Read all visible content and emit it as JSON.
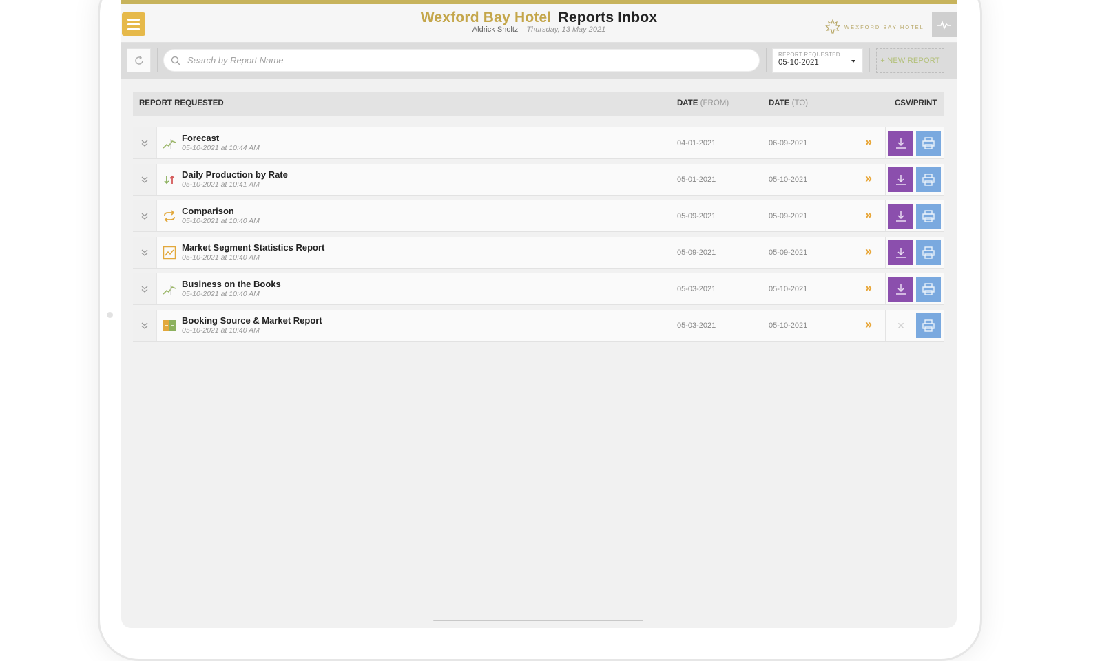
{
  "header": {
    "hotel_name": "Wexford Bay Hotel",
    "page_title": "Reports Inbox",
    "user_name": "Aldrick Sholtz",
    "date": "Thursday, 13 May 2021",
    "logo_text": "WEXFORD BAY HOTEL",
    "menu_icon": "hamburger-icon",
    "activity_icon": "pulse-icon",
    "accent_color": "#c4a64a"
  },
  "toolbar": {
    "search_placeholder": "Search by Report Name",
    "search_value": "",
    "date_filter_label": "REPORT REQUESTED",
    "date_filter_value": "05-10-2021",
    "new_report_label": "+ NEW REPORT"
  },
  "table": {
    "columns": {
      "report": "REPORT REQUESTED",
      "date_from": "DATE",
      "date_from_suffix": "(FROM)",
      "date_to": "DATE",
      "date_to_suffix": "(TO)",
      "actions": "CSV/PRINT"
    },
    "rows": [
      {
        "name": "Forecast",
        "requested": "05-10-2021 at 10:44 AM",
        "date_from": "04-01-2021",
        "date_to": "06-09-2021",
        "icon": "trend-line-icon",
        "csv_available": true
      },
      {
        "name": "Daily Production by Rate",
        "requested": "05-10-2021 at 10:41 AM",
        "date_from": "05-01-2021",
        "date_to": "05-10-2021",
        "icon": "up-down-arrows-icon",
        "csv_available": true
      },
      {
        "name": "Comparison",
        "requested": "05-10-2021 at 10:40 AM",
        "date_from": "05-09-2021",
        "date_to": "05-09-2021",
        "icon": "swap-arrows-icon",
        "csv_available": true
      },
      {
        "name": "Market Segment Statistics Report",
        "requested": "05-10-2021 at 10:40 AM",
        "date_from": "05-09-2021",
        "date_to": "05-09-2021",
        "icon": "line-chart-box-icon",
        "csv_available": true
      },
      {
        "name": "Business on the Books",
        "requested": "05-10-2021 at 10:40 AM",
        "date_from": "05-03-2021",
        "date_to": "05-10-2021",
        "icon": "trend-line-icon",
        "csv_available": true
      },
      {
        "name": "Booking Source & Market Report",
        "requested": "05-10-2021 at 10:40 AM",
        "date_from": "05-03-2021",
        "date_to": "05-10-2021",
        "icon": "split-box-icon",
        "csv_available": false
      }
    ]
  },
  "colors": {
    "csv_button": "#8b4fad",
    "print_button": "#7aa9df",
    "open_chevron": "#e8a637"
  }
}
